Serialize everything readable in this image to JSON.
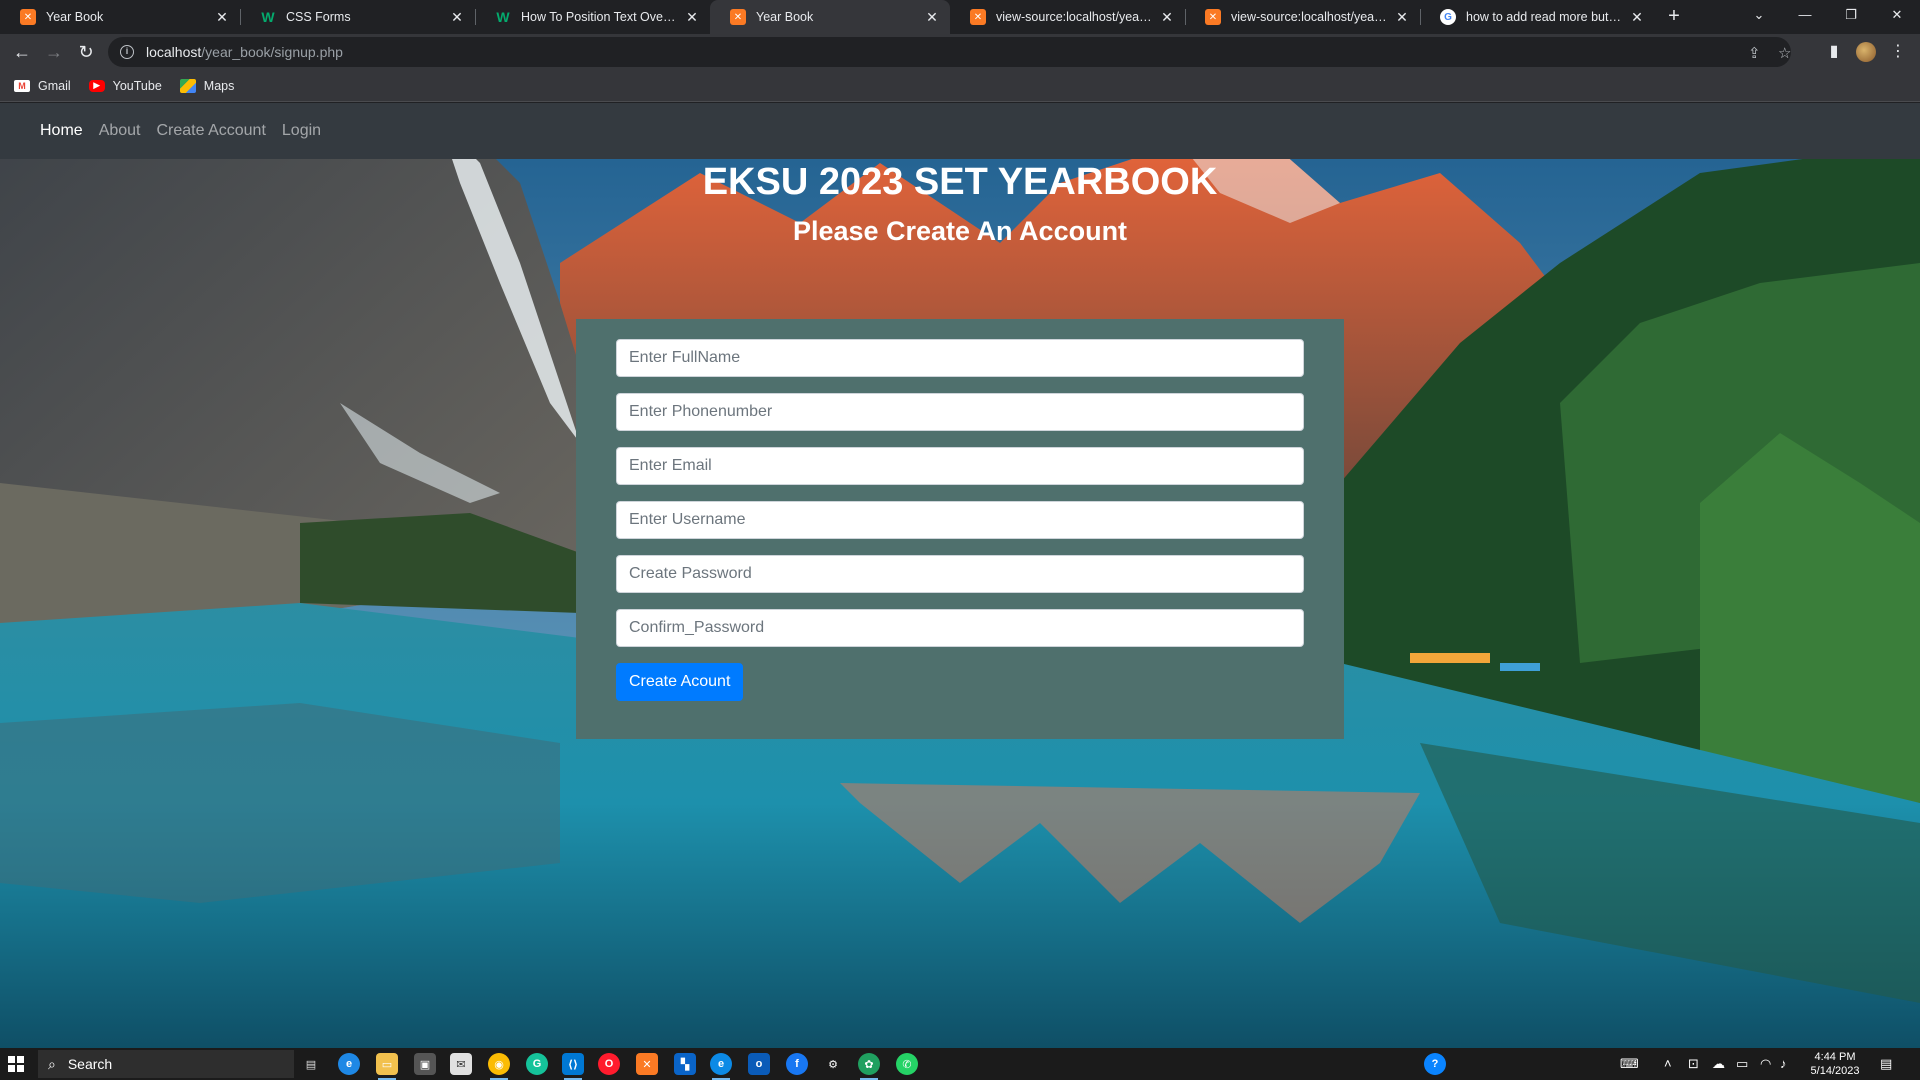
{
  "browser": {
    "tabs": [
      {
        "title": "Year Book",
        "favicon": "xampp-icon",
        "active": false
      },
      {
        "title": "CSS Forms",
        "favicon": "w3schools-icon",
        "active": false
      },
      {
        "title": "How To Position Text Over an Im",
        "favicon": "w3schools-icon",
        "active": false
      },
      {
        "title": "Year Book",
        "favicon": "xampp-icon",
        "active": true
      },
      {
        "title": "view-source:localhost/year_book",
        "favicon": "xampp-icon",
        "active": false
      },
      {
        "title": "view-source:localhost/year_book",
        "favicon": "xampp-icon",
        "active": false
      },
      {
        "title": "how to add read more button in",
        "favicon": "google-icon",
        "active": false
      }
    ],
    "url_host": "localhost",
    "url_path": "/year_book/signup.php",
    "bookmarks": [
      {
        "label": "Gmail",
        "icon": "gmail-icon"
      },
      {
        "label": "YouTube",
        "icon": "youtube-icon"
      },
      {
        "label": "Maps",
        "icon": "maps-icon"
      }
    ]
  },
  "nav": {
    "home": "Home",
    "about": "About",
    "create_account": "Create Account",
    "login": "Login"
  },
  "hero": {
    "title": "EKSU 2023 SET YEARBOOK",
    "subtitle": "Please Create An Account"
  },
  "form": {
    "fullname_placeholder": "Enter FullName",
    "phone_placeholder": "Enter Phonenumber",
    "email_placeholder": "Enter Email",
    "username_placeholder": "Enter Username",
    "password_placeholder": "Create Password",
    "confirm_placeholder": "Confirm_Password",
    "submit_label": "Create Acount"
  },
  "taskbar": {
    "search_label": "Search",
    "time": "4:44 PM",
    "date": "5/14/2023"
  },
  "colors": {
    "navbar_bg": "#343a40",
    "panel_bg": "#4f706d",
    "button_bg": "#007bff"
  }
}
